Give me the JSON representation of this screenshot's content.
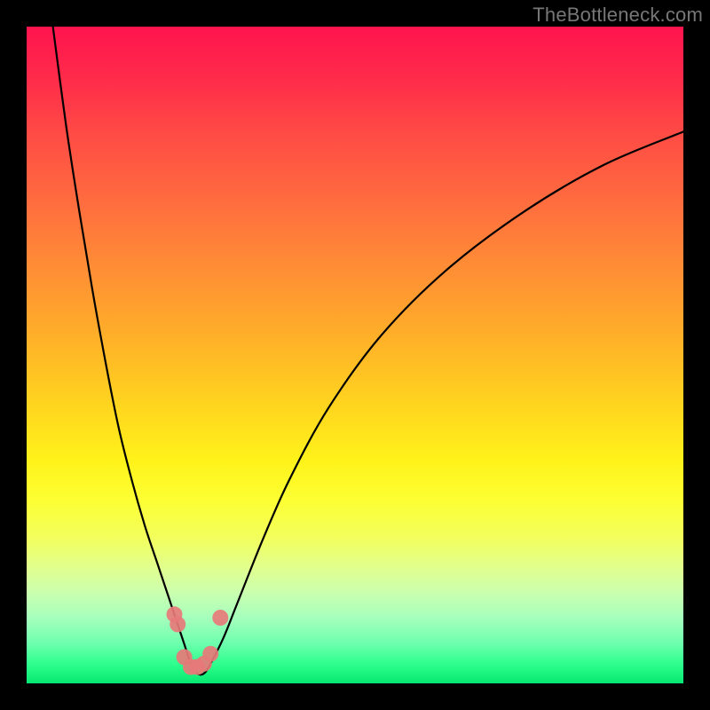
{
  "watermark": {
    "text": "TheBottleneck.com"
  },
  "chart_data": {
    "type": "line",
    "title": "",
    "xlabel": "",
    "ylabel": "",
    "xlim": [
      0,
      100
    ],
    "ylim": [
      0,
      100
    ],
    "grid": false,
    "legend": false,
    "background_gradient": {
      "top_color": "#ff144e",
      "mid_color": "#ffe41a",
      "bottom_color": "#07e870"
    },
    "series": [
      {
        "name": "bottleneck-curve",
        "stroke": "#000000",
        "x": [
          4,
          6,
          8,
          10,
          12,
          14,
          16,
          18,
          20,
          22,
          24,
          25,
          26,
          27,
          28,
          30,
          32,
          36,
          40,
          46,
          54,
          64,
          76,
          88,
          100
        ],
        "values": [
          100,
          85,
          72,
          60,
          49,
          39,
          31,
          24,
          18,
          12,
          6,
          3,
          1.5,
          1.5,
          3,
          7,
          12,
          22,
          31,
          42,
          53,
          63,
          72,
          79,
          84
        ]
      },
      {
        "name": "marker-cluster",
        "type": "scatter",
        "color": "#e77a7a",
        "x": [
          22.5,
          23.0,
          24.0,
          25.0,
          26.0,
          27.0,
          28.0,
          29.5
        ],
        "values": [
          10.5,
          9.0,
          4.0,
          2.5,
          2.5,
          3.0,
          4.5,
          10.0
        ]
      }
    ]
  }
}
